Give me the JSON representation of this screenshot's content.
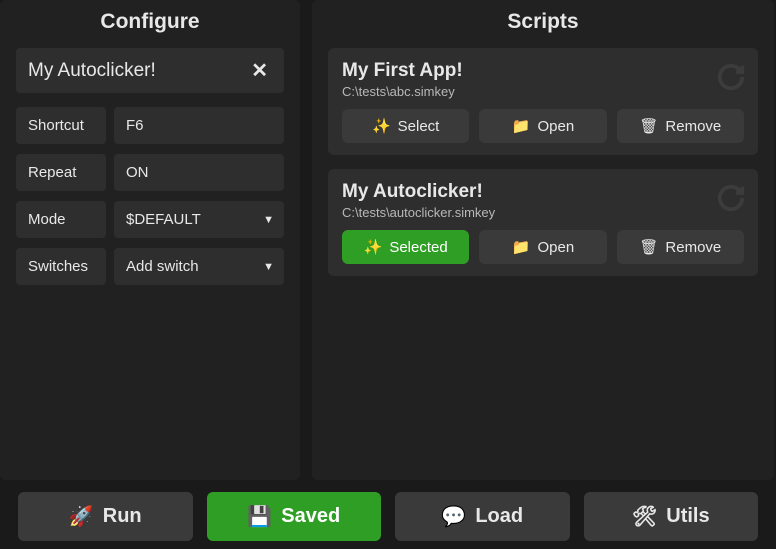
{
  "configure": {
    "title": "Configure",
    "current_name": "My Autoclicker!",
    "close_glyph": "✕",
    "fields": {
      "shortcut_label": "Shortcut",
      "shortcut_value": "F6",
      "repeat_label": "Repeat",
      "repeat_value": "ON",
      "mode_label": "Mode",
      "mode_value": "$DEFAULT",
      "switches_label": "Switches",
      "switches_value": "Add switch"
    }
  },
  "scripts": {
    "title": "Scripts",
    "items": [
      {
        "name": "My First App!",
        "path": "C:\\tests\\abc.simkey",
        "selected": false,
        "select_label": "Select",
        "open_label": "Open",
        "remove_label": "Remove"
      },
      {
        "name": "My Autoclicker!",
        "path": "C:\\tests\\autoclicker.simkey",
        "selected": true,
        "select_label": "Selected",
        "open_label": "Open",
        "remove_label": "Remove"
      }
    ]
  },
  "bottom": {
    "run": "Run",
    "saved": "Saved",
    "load": "Load",
    "utils": "Utils"
  },
  "icons": {
    "sparkles": "✨",
    "folder": "📁",
    "trash": "🗑",
    "rocket": "🚀",
    "save": "💾",
    "chat": "💬",
    "tools": "🛠",
    "refresh": "⟳"
  },
  "colors": {
    "accent_green": "#2f9e24",
    "panel_bg": "#212121",
    "card_bg": "#2e2e2e",
    "button_bg": "#3a3a3a"
  }
}
